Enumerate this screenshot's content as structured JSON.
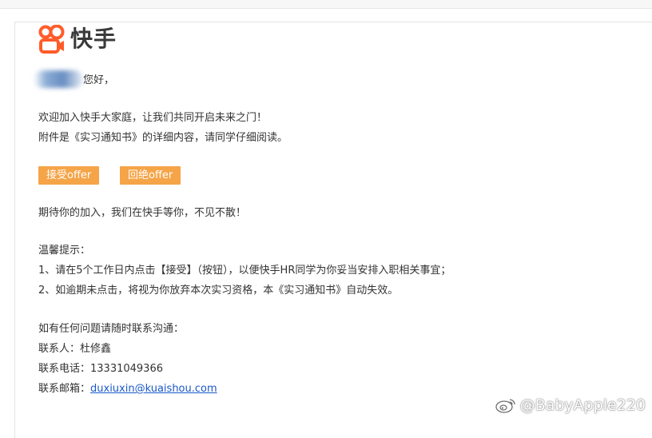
{
  "brand": {
    "name": "快手",
    "accent": "#f5a447",
    "logo_color": "#ff5c2a"
  },
  "greeting": {
    "salutation": "您好，"
  },
  "intro": {
    "line1": "欢迎加入快手大家庭，让我们共同开启未来之门！",
    "line2": "附件是《实习通知书》的详细内容，请同学仔细阅读。"
  },
  "actions": {
    "accept_label": "接受offer",
    "reject_label": "回绝offer"
  },
  "closing": "期待你的加入，我们在快手等你，不见不散！",
  "tips": {
    "heading": "温馨提示：",
    "item1": "1、请在5个工作日内点击【接受】（按钮），以便快手HR同学为你妥当安排入职相关事宜；",
    "item2": "2、如逾期未点击，将视为你放弃本次实习资格，本《实习通知书》自动失效。"
  },
  "contact": {
    "heading": "如有任何问题请随时联系沟通：",
    "person_label": "联系人：",
    "person": "杜修鑫",
    "phone_label": "联系电话：",
    "phone": "13331049366",
    "email_label": "联系邮箱：",
    "email": "duxiuxin@kuaishou.com"
  },
  "watermark": {
    "text": "@BabyApple220",
    "icon": "weibo-icon"
  }
}
